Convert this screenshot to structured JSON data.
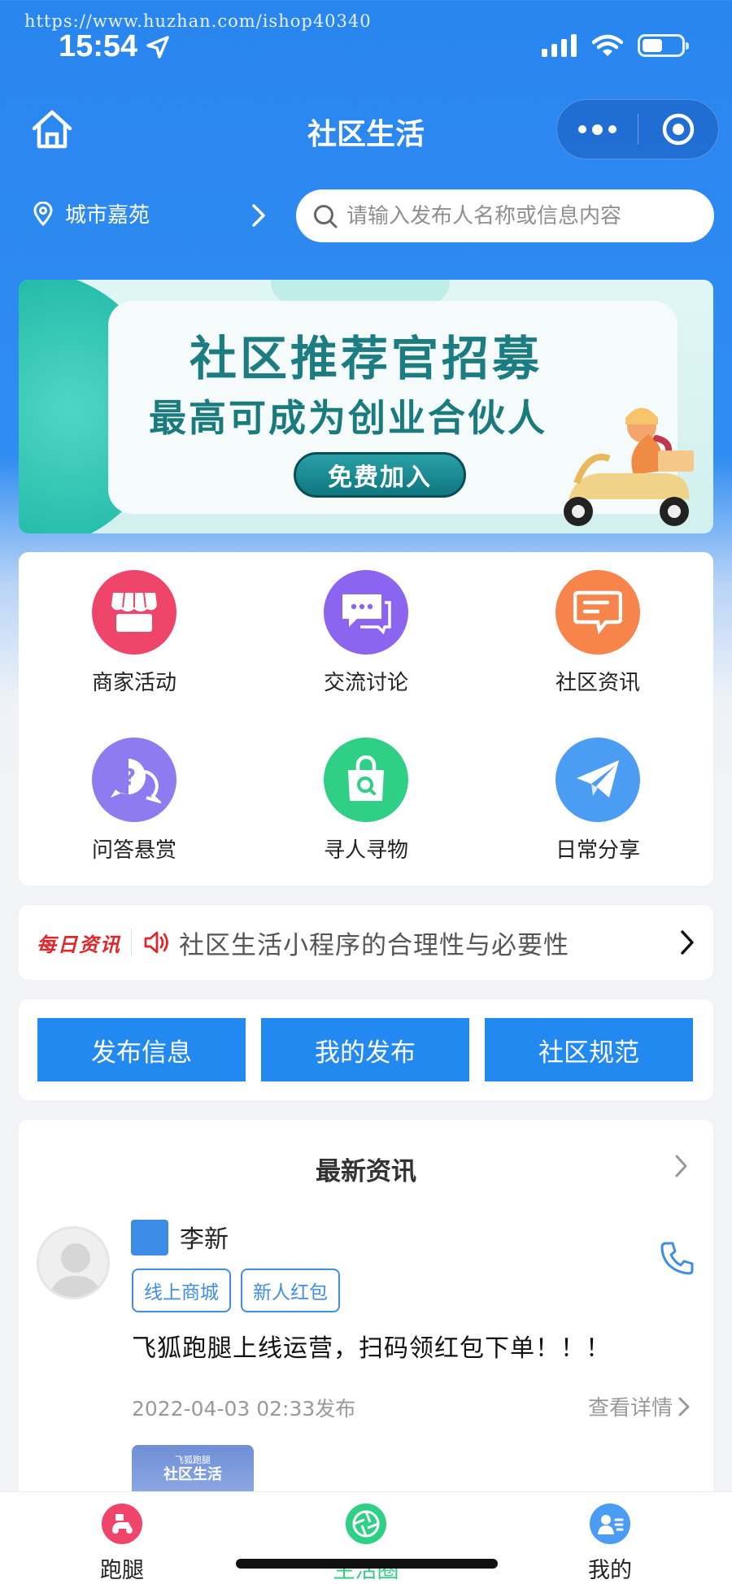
{
  "status_bar": {
    "watermark": "https://www.huzhan.com/ishop40340",
    "time": "15:54"
  },
  "nav": {
    "title": "社区生活"
  },
  "location": {
    "label": "城市嘉苑"
  },
  "search": {
    "placeholder": "请输入发布人名称或信息内容"
  },
  "banner": {
    "title": "社区推荐官招募",
    "subtitle": "最高可成为创业合伙人",
    "button": "免费加入"
  },
  "categories": [
    {
      "label": "商家活动",
      "icon": "shop-icon",
      "color": "#f0456b"
    },
    {
      "label": "交流讨论",
      "icon": "chat-icon",
      "color": "#8b64ef"
    },
    {
      "label": "社区资讯",
      "icon": "message-icon",
      "color": "#f7844a"
    },
    {
      "label": "问答悬赏",
      "icon": "question-icon",
      "color": "#8f7bf0"
    },
    {
      "label": "寻人寻物",
      "icon": "bag-search-icon",
      "color": "#2fcf86"
    },
    {
      "label": "日常分享",
      "icon": "paper-plane-icon",
      "color": "#4a9df3"
    }
  ],
  "ticker": {
    "tag": "每日资讯",
    "text": "社区生活小程序的合理性与必要性"
  },
  "actions": {
    "publish": "发布信息",
    "my_posts": "我的发布",
    "rules": "社区规范"
  },
  "latest": {
    "title": "最新资讯",
    "post": {
      "author": "李新",
      "tags": [
        "线上商城",
        "新人红包"
      ],
      "text": "飞狐跑腿上线运营，扫码领红包下单！！！",
      "date": "2022-04-03 02:33发布",
      "detail": "查看详情",
      "thumb_small": "飞狐跑腿",
      "thumb_title": "社区生活"
    }
  },
  "tabs": {
    "errand": "跑腿",
    "life": "生活圈",
    "me": "我的"
  },
  "colors": {
    "primary": "#2289f0",
    "header": "#2a86ef",
    "ticker_tag": "#e0252b"
  }
}
